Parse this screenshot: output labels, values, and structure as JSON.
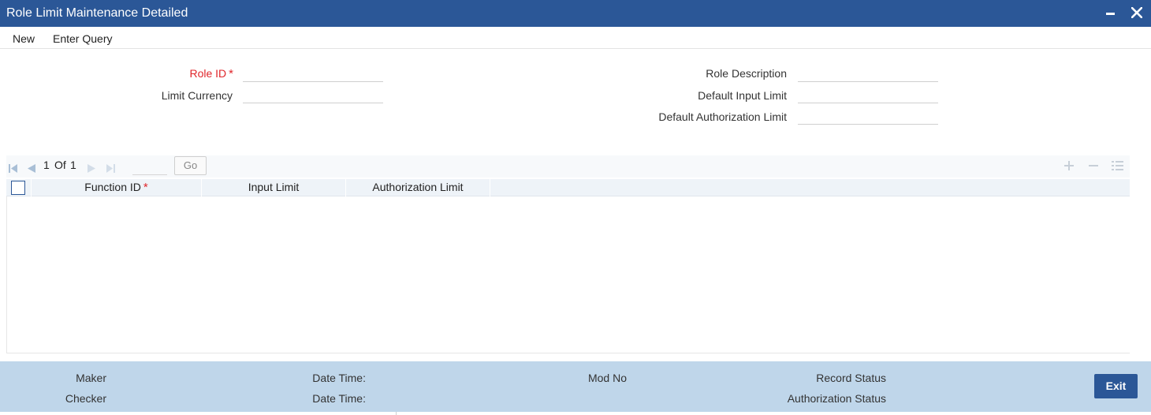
{
  "window": {
    "title": "Role Limit Maintenance Detailed",
    "minimize_icon": "minimize-icon",
    "close_icon": "close-icon"
  },
  "menu": {
    "new_label": "New",
    "enter_query_label": "Enter Query"
  },
  "form": {
    "role_id": {
      "label": "Role ID",
      "required_marker": "*",
      "value": ""
    },
    "limit_currency": {
      "label": "Limit Currency",
      "value": ""
    },
    "role_description": {
      "label": "Role Description",
      "value": ""
    },
    "default_input_limit": {
      "label": "Default Input Limit",
      "value": ""
    },
    "default_authorization_limit": {
      "label": "Default Authorization Limit",
      "value": ""
    }
  },
  "grid": {
    "pager": {
      "current": "1",
      "of_label": "Of",
      "total": "1",
      "page_input": "",
      "go_label": "Go"
    },
    "toolbar_icons": [
      "add-row-icon",
      "delete-row-icon",
      "single-view-icon"
    ],
    "columns": [
      {
        "label": "Function ID",
        "required_marker": "*"
      },
      {
        "label": "Input Limit"
      },
      {
        "label": "Authorization Limit"
      }
    ],
    "rows": []
  },
  "footer": {
    "maker_label": "Maker",
    "checker_label": "Checker",
    "date_time_label_1": "Date Time:",
    "date_time_label_2": "Date Time:",
    "mod_no_label": "Mod No",
    "record_status_label": "Record Status",
    "authorization_status_label": "Authorization Status",
    "exit_label": "Exit"
  },
  "colors": {
    "title_bar": "#2b5797",
    "required": "#e0262b",
    "footer_bg": "#bfd6ea",
    "grid_header_bg": "#eef3f8"
  }
}
